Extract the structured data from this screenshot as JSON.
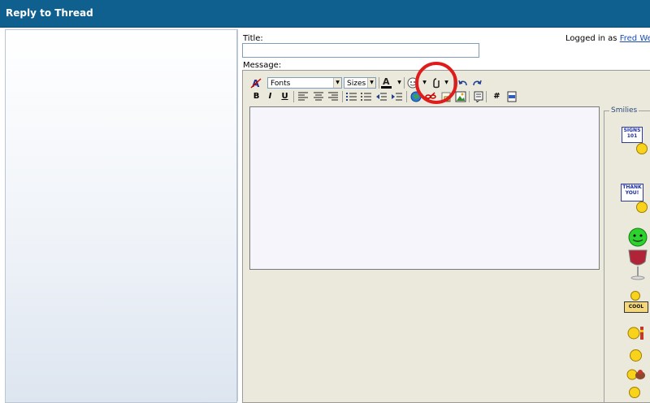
{
  "window": {
    "title": "Reply to Thread"
  },
  "form": {
    "title_label": "Title:",
    "title_value": "",
    "message_label": "Message:",
    "logged_in_prefix": "Logged in as",
    "logged_in_user": "Fred Weis"
  },
  "toolbar": {
    "font_select": "Fonts",
    "size_select": "Sizes",
    "bold": "B",
    "italic": "I",
    "underline": "U",
    "hash": "#"
  },
  "smilies": {
    "label": "Smilies",
    "items": [
      {
        "icon": "signs-101-smilie-icon",
        "sign_line1": "SIGNS",
        "sign_line2": "101"
      },
      {
        "icon": "thank-you-smilie-icon",
        "sign_line1": "THANK",
        "sign_line2": "YOU!"
      },
      {
        "icon": "wine-glass-smilie-icon"
      },
      {
        "icon": "cool-sign-smilie-icon",
        "sign_line1": "COOL"
      },
      {
        "icon": "thinking-smilie-icon"
      },
      {
        "icon": "confused-smilie-icon"
      },
      {
        "icon": "dog-smilie-icon"
      },
      {
        "icon": "smile-smilie-icon"
      }
    ]
  },
  "colors": {
    "titlebar": "#0f5f8f",
    "highlight_circle": "#e01b1b",
    "editor_bg": "#ebe9dc"
  }
}
